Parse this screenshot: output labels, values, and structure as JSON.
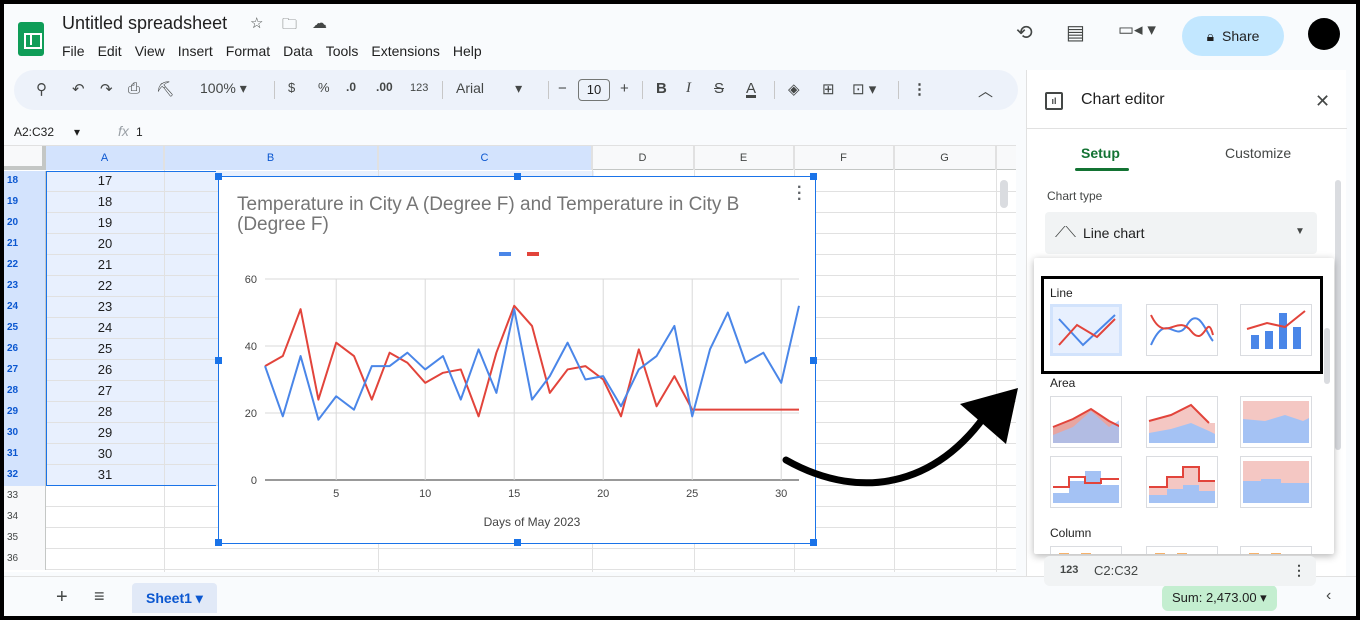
{
  "doc": {
    "title": "Untitled spreadsheet",
    "menu": [
      "File",
      "Edit",
      "View",
      "Insert",
      "Format",
      "Data",
      "Tools",
      "Extensions",
      "Help"
    ],
    "share_label": "Share"
  },
  "toolbar": {
    "zoom": "100%",
    "currency": "$",
    "percent": "%",
    "decimal_decrease": ".0",
    "decimal_increase": ".00",
    "number_format": "123",
    "font": "Arial",
    "font_size": "10"
  },
  "formula_bar": {
    "name_box": "A2:C32",
    "fx": "fx",
    "value": "1"
  },
  "grid": {
    "columns": [
      "A",
      "B",
      "C",
      "D",
      "E",
      "F",
      "G"
    ],
    "rows": [
      {
        "num": "18",
        "a": "17"
      },
      {
        "num": "19",
        "a": "18"
      },
      {
        "num": "20",
        "a": "19"
      },
      {
        "num": "21",
        "a": "20"
      },
      {
        "num": "22",
        "a": "21"
      },
      {
        "num": "23",
        "a": "22"
      },
      {
        "num": "24",
        "a": "23"
      },
      {
        "num": "25",
        "a": "24"
      },
      {
        "num": "26",
        "a": "25"
      },
      {
        "num": "27",
        "a": "26"
      },
      {
        "num": "28",
        "a": "27"
      },
      {
        "num": "29",
        "a": "28"
      },
      {
        "num": "30",
        "a": "29"
      },
      {
        "num": "31",
        "a": "30"
      },
      {
        "num": "32",
        "a": "31"
      },
      {
        "num": "33",
        "a": ""
      },
      {
        "num": "34",
        "a": ""
      },
      {
        "num": "35",
        "a": ""
      },
      {
        "num": "36",
        "a": ""
      }
    ],
    "selected_row_count": 15
  },
  "chart_data": {
    "type": "line",
    "title": "Temperature in City A (Degree F) and Temperature in City B (Degree F)",
    "xlabel": "Days of May 2023",
    "ylabel": "",
    "xlim": [
      1,
      31
    ],
    "ylim": [
      0,
      60
    ],
    "x_ticks": [
      "5",
      "10",
      "15",
      "20",
      "25",
      "30"
    ],
    "y_ticks": [
      "0",
      "20",
      "40",
      "60"
    ],
    "grid": true,
    "legend": "top-center",
    "x": [
      1,
      2,
      3,
      4,
      5,
      6,
      7,
      8,
      9,
      10,
      11,
      12,
      13,
      14,
      15,
      16,
      17,
      18,
      19,
      20,
      21,
      22,
      23,
      24,
      25,
      26,
      27,
      28,
      29,
      30,
      31
    ],
    "series": [
      {
        "color": "#4a86e8",
        "values": [
          34,
          19,
          37,
          18,
          25,
          21,
          34,
          34,
          38,
          33,
          37,
          24,
          39,
          26,
          51,
          24,
          31,
          41,
          30,
          31,
          22,
          33,
          37,
          46,
          19,
          39,
          50,
          35,
          38,
          29,
          52
        ]
      },
      {
        "color": "#e2443b",
        "values": [
          34,
          37,
          51,
          24,
          41,
          37,
          24,
          38,
          35,
          29,
          32,
          33,
          19,
          38,
          52,
          46,
          26,
          33,
          34,
          30,
          19,
          39,
          22,
          31,
          21,
          21,
          21,
          21,
          21,
          21,
          21
        ]
      }
    ]
  },
  "editor": {
    "title": "Chart editor",
    "tab_setup": "Setup",
    "tab_customize": "Customize",
    "chart_type_label": "Chart type",
    "chart_type_value": "Line chart",
    "groups": [
      "Line",
      "Area",
      "Column"
    ],
    "series_icon": "123",
    "series_range": "C2:C32"
  },
  "bottom": {
    "sheet_name": "Sheet1",
    "sum": "Sum: 2,473.00"
  },
  "colors": {
    "accent_green": "#0f9d58",
    "share_bg": "#c2e7ff",
    "selection": "#1a73e8",
    "series_a": "#4a86e8",
    "series_b": "#e2443b"
  }
}
